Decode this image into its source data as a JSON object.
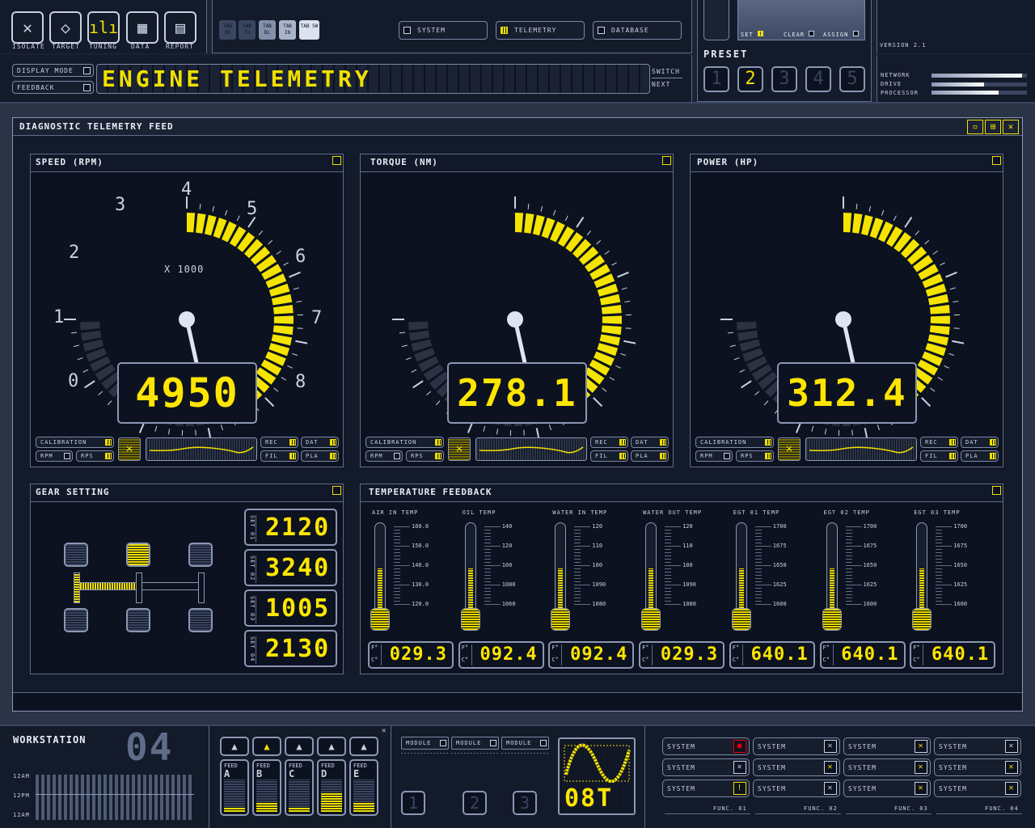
{
  "top": {
    "tools": [
      "ISOLATE",
      "TARGET",
      "TUNING",
      "DATA",
      "REPORT"
    ],
    "tabs": [
      "TAB OG",
      "TAB TU",
      "TAB DL",
      "TAB IN",
      "TAB SW"
    ],
    "nav": [
      "SYSTEM",
      "TELEMETRY",
      "DATABASE"
    ],
    "display_mode": "DISPLAY MODE",
    "feedback": "FEEDBACK",
    "banner": "ENGINE TELEMETRY",
    "switch": "SWITCH",
    "next": "NEXT",
    "set": "SET",
    "clear": "CLEAR",
    "assign": "ASSIGN",
    "preset_label": "PRESET",
    "presets": [
      "1",
      "2",
      "3",
      "4",
      "5"
    ],
    "version": "VERSION 2.1",
    "status": [
      {
        "label": "NETWORK",
        "level": 0.95
      },
      {
        "label": "DRIVE",
        "level": 0.55
      },
      {
        "label": "PROCESSOR",
        "level": 0.7
      }
    ]
  },
  "main": {
    "title": "DIAGNOSTIC TELEMETRY FEED",
    "gauges": [
      {
        "title": "SPEED (RPM)",
        "readout": "4950",
        "unit_note": "X 1000",
        "ticks": [
          "0",
          "1",
          "2",
          "3",
          "4",
          "5",
          "6",
          "7",
          "8"
        ],
        "level": 0.62
      },
      {
        "title": "TORQUE (NM)",
        "readout": "278.1",
        "level": 0.62
      },
      {
        "title": "POWER (HP)",
        "readout": "312.4",
        "level": 0.62
      }
    ],
    "controls": {
      "calibration": "CALIBRATION",
      "rpm": "RPM",
      "rps": "RPS",
      "rec": "REC",
      "dat": "DAT",
      "fil": "FIL",
      "pla": "PLA"
    },
    "gear": {
      "title": "GEAR SETTING",
      "sets": [
        {
          "label": "SET 01",
          "value": "2120"
        },
        {
          "label": "SET 02",
          "value": "3240"
        },
        {
          "label": "SET 03",
          "value": "1005"
        },
        {
          "label": "SET 04",
          "value": "2130"
        }
      ]
    },
    "temps": {
      "title": "TEMPERATURE FEEDBACK",
      "sensors": [
        {
          "name": "AIR IN TEMP",
          "scale": [
            "160.0",
            "150.0",
            "140.0",
            "130.0",
            "120.0"
          ],
          "value": "029.3",
          "level": 0.45
        },
        {
          "name": "OIL TEMP",
          "scale": [
            "140",
            "120",
            "100",
            "1080",
            "1060"
          ],
          "value": "092.4",
          "level": 0.45
        },
        {
          "name": "WATER IN TEMP",
          "scale": [
            "120",
            "110",
            "100",
            "1090",
            "1080"
          ],
          "value": "092.4",
          "level": 0.45
        },
        {
          "name": "WATER OUT TEMP",
          "scale": [
            "120",
            "110",
            "100",
            "1090",
            "1080"
          ],
          "value": "029.3",
          "level": 0.45
        },
        {
          "name": "EGT 01 TEMP",
          "scale": [
            "1700",
            "1675",
            "1650",
            "1625",
            "1600"
          ],
          "value": "640.1",
          "level": 0.45
        },
        {
          "name": "EGT 02 TEMP",
          "scale": [
            "1700",
            "1675",
            "1650",
            "1625",
            "1600"
          ],
          "value": "640.1",
          "level": 0.45
        },
        {
          "name": "EGT 03 TEMP",
          "scale": [
            "1700",
            "1675",
            "1650",
            "1625",
            "1600"
          ],
          "value": "640.1",
          "level": 0.45
        }
      ],
      "f": "F°",
      "c": "C°"
    }
  },
  "bottom": {
    "workstation": "WORKSTATION",
    "ws_number": "04",
    "times": [
      "12AM",
      "12PM",
      "12AM"
    ],
    "feeds": [
      {
        "label": "FEED",
        "letter": "A",
        "level": 0.15
      },
      {
        "label": "FEED",
        "letter": "B",
        "level": 0.3
      },
      {
        "label": "FEED",
        "letter": "C",
        "level": 0.15
      },
      {
        "label": "FEED",
        "letter": "D",
        "level": 0.6
      },
      {
        "label": "FEED",
        "letter": "E",
        "level": 0.3
      }
    ],
    "modules": [
      "MODULE",
      "MODULE",
      "MODULE"
    ],
    "module_nums": [
      "1",
      "2",
      "3"
    ],
    "scope_readout": "08T",
    "system_label": "SYSTEM",
    "funcs": [
      "FUNC. 01",
      "FUNC. 02",
      "FUNC. 03",
      "FUNC. 04"
    ]
  },
  "colors": {
    "accent": "#ffe600",
    "panel": "#0d1220",
    "frame": "#2b3446",
    "border": "#5f6c88"
  }
}
